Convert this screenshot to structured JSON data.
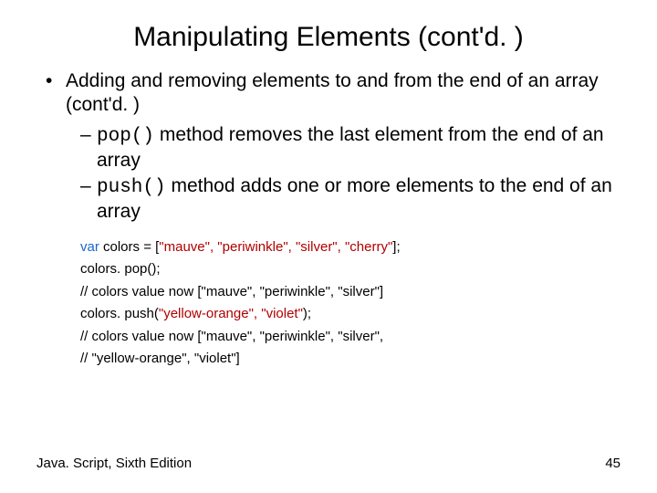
{
  "title": "Manipulating Elements (cont'd. )",
  "bullet1": "Adding and removing elements to and from the end of an array (cont'd. )",
  "sub1": {
    "code": "pop()",
    "rest": " method removes the last element from the end of an array"
  },
  "sub2": {
    "code": "push()",
    "rest": " method adds one or more elements to the end of an array"
  },
  "code": {
    "l1a": "var",
    "l1b": " colors = [",
    "l1c": "\"mauve\", \"periwinkle\", \"silver\", \"cherry\"",
    "l1d": "];",
    "l2": "colors. pop();",
    "l3": "// colors value now [\"mauve\", \"periwinkle\", \"silver\"]",
    "l4a": "colors. push(",
    "l4b": "\"yellow-orange\", \"violet\"",
    "l4c": ");",
    "l5": "// colors value now [\"mauve\", \"periwinkle\", \"silver\",",
    "l6": "// \"yellow-orange\", \"violet\"]"
  },
  "footer": {
    "left": "Java. Script, Sixth Edition",
    "right": "45"
  }
}
